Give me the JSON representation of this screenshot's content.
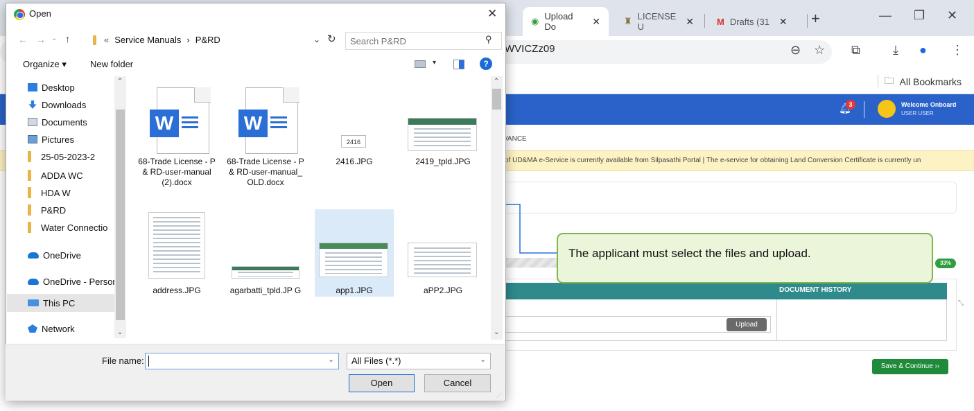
{
  "browser": {
    "tabs": [
      {
        "label": "Upload Do",
        "active": true
      },
      {
        "label": "LICENSE U",
        "active": false
      },
      {
        "label": "Drafts (31",
        "active": false
      }
    ],
    "url_fragment": "WVICZz09",
    "bookmarks_label": "All Bookmarks"
  },
  "webapp": {
    "header_color": "#2a62c9",
    "notification_count": "3",
    "welcome_text": "Welcome Onboard",
    "user_text": "USER USER",
    "menu_item": "VANCE",
    "notice_text": "of UD&MA e-Service is currently available from Silpasathi Portal | The e-service for obtaining Land Conversion Certificate is currently un",
    "progress_badge": "33%",
    "progress_value": 0.33,
    "document_history_header": "DOCUMENT HISTORY",
    "upload_label": "Upload",
    "save_continue_label": "Save & Continue ››"
  },
  "callout": {
    "text": "The applicant must select the files and upload."
  },
  "dialog": {
    "title": "Open",
    "breadcrumb": [
      "«",
      "Service Manuals",
      "›",
      "P&RD"
    ],
    "search_placeholder": "Search P&RD",
    "organize_label": "Organize ▾",
    "new_folder_label": "New folder",
    "help_label": "?",
    "nav_items": [
      {
        "label": "Desktop",
        "icon": "desktop-icon",
        "pinned": true
      },
      {
        "label": "Downloads",
        "icon": "downloads-icon",
        "pinned": true
      },
      {
        "label": "Documents",
        "icon": "documents-icon",
        "pinned": true
      },
      {
        "label": "Pictures",
        "icon": "pictures-icon",
        "pinned": true
      },
      {
        "label": "25-05-2023-2",
        "icon": "folder-icon",
        "pinned": true
      },
      {
        "label": "ADDA WC",
        "icon": "folder-icon",
        "pinned": false
      },
      {
        "label": "HDA W",
        "icon": "folder-icon",
        "pinned": false
      },
      {
        "label": "P&RD",
        "icon": "folder-icon",
        "pinned": false
      },
      {
        "label": "Water Connectio",
        "icon": "folder-icon",
        "pinned": false
      },
      {
        "label": "OneDrive",
        "icon": "onedrive-icon",
        "pinned": false
      },
      {
        "label": "OneDrive - Person",
        "icon": "onedrive-icon",
        "pinned": false
      },
      {
        "label": "This PC",
        "icon": "this-pc-icon",
        "pinned": false
      },
      {
        "label": "Network",
        "icon": "network-icon",
        "pinned": false
      }
    ],
    "files": [
      {
        "label": "68-Trade License - P & RD-user-manual (2).docx",
        "type": "word"
      },
      {
        "label": "68-Trade License - P & RD-user-manual_ OLD.docx",
        "type": "word"
      },
      {
        "label": "2416.JPG",
        "type": "image"
      },
      {
        "label": "2419_tpld.JPG",
        "type": "image"
      },
      {
        "label": "address.JPG",
        "type": "image"
      },
      {
        "label": "agarbatti_tpld.JP G",
        "type": "image"
      },
      {
        "label": "app1.JPG",
        "type": "image",
        "selected": true
      },
      {
        "label": "aPP2.JPG",
        "type": "image"
      }
    ],
    "thumb_2416_text": "2416",
    "file_name_label": "File name:",
    "file_name_value": "",
    "file_type_value": "All Files (*.*)",
    "open_label": "Open",
    "cancel_label": "Cancel"
  }
}
